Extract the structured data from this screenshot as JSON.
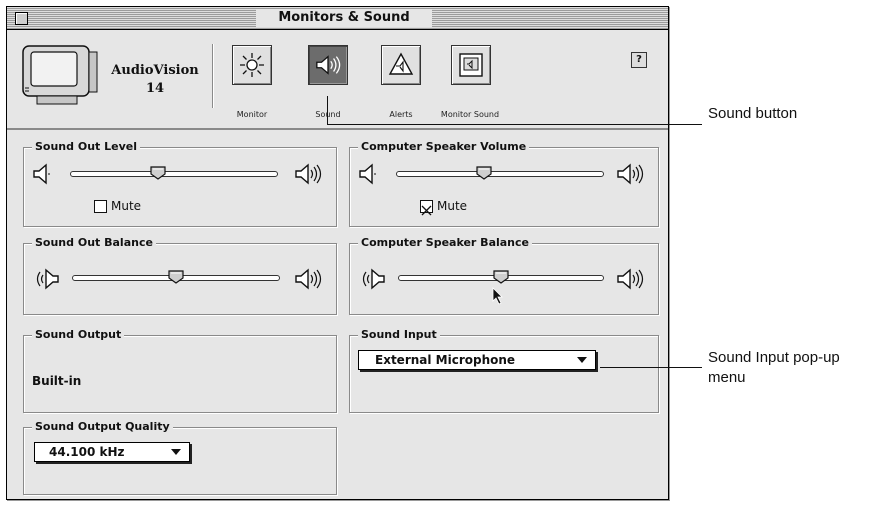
{
  "window": {
    "title": "Monitors & Sound"
  },
  "header": {
    "monitor_name_line1": "AudioVision",
    "monitor_name_line2": "14",
    "panels": [
      {
        "label": "Monitor",
        "icon": "sun-icon",
        "selected": false
      },
      {
        "label": "Sound",
        "icon": "speaker-icon",
        "selected": true
      },
      {
        "label": "Alerts",
        "icon": "alert-icon",
        "selected": false
      },
      {
        "label": "Monitor Sound",
        "icon": "monitor-sound-icon",
        "selected": false
      }
    ],
    "help_glyph": "?"
  },
  "sound_out_level": {
    "title": "Sound Out Level",
    "level": 0.42,
    "mute_label": "Mute",
    "muted": false
  },
  "computer_speaker_volume": {
    "title": "Computer Speaker Volume",
    "level": 0.42,
    "mute_label": "Mute",
    "muted": true
  },
  "sound_out_balance": {
    "title": "Sound Out Balance",
    "level": 0.5
  },
  "computer_speaker_balance": {
    "title": "Computer Speaker Balance",
    "level": 0.5
  },
  "sound_output": {
    "title": "Sound Output",
    "value": "Built-in"
  },
  "sound_input": {
    "title": "Sound Input",
    "value": "External Microphone"
  },
  "sound_output_quality": {
    "title": "Sound Output Quality",
    "value": "44.100 kHz"
  },
  "callouts": {
    "sound_button": "Sound button",
    "sound_input_menu_line1": "Sound Input pop-up",
    "sound_input_menu_line2": "menu"
  }
}
